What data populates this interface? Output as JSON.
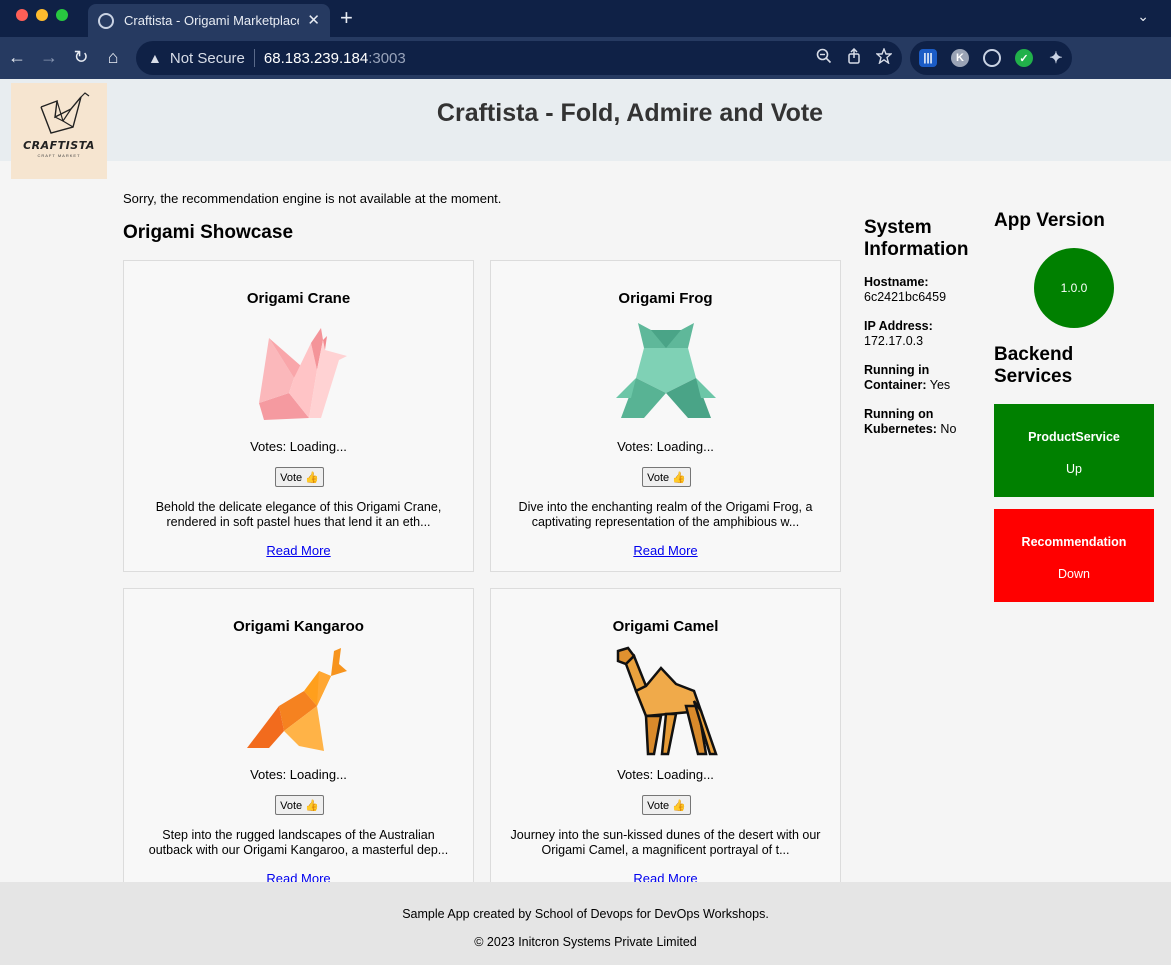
{
  "browser": {
    "tab_title": "Craftista - Origami Marketplace",
    "tab_close": "✕",
    "new_tab": "+",
    "security_label": "Not Secure",
    "url_host": "68.183.239.184",
    "url_port": ":3003",
    "ext_k": "K"
  },
  "header": {
    "logo_text": "CRAFTISTA",
    "logo_sub": "CRAFT MARKET",
    "title": "Craftista - Fold, Admire and Vote"
  },
  "main": {
    "recommendation_message": "Sorry, the recommendation engine is not available at the moment.",
    "showcase_title": "Origami Showcase",
    "products": [
      {
        "title": "Origami Crane",
        "votes": "Votes: Loading...",
        "vote_label": "Vote 👍",
        "description": "Behold the delicate elegance of this Origami Crane, rendered in soft pastel hues that lend it an eth...",
        "read_more": "Read More"
      },
      {
        "title": "Origami Frog",
        "votes": "Votes: Loading...",
        "vote_label": "Vote 👍",
        "description": "Dive into the enchanting realm of the Origami Frog, a captivating representation of the amphibious w...",
        "read_more": "Read More"
      },
      {
        "title": "Origami Kangaroo",
        "votes": "Votes: Loading...",
        "vote_label": "Vote 👍",
        "description": "Step into the rugged landscapes of the Australian outback with our Origami Kangaroo, a masterful dep...",
        "read_more": "Read More"
      },
      {
        "title": "Origami Camel",
        "votes": "Votes: Loading...",
        "vote_label": "Vote 👍",
        "description": "Journey into the sun-kissed dunes of the desert with our Origami Camel, a magnificent portrayal of t...",
        "read_more": "Read More"
      }
    ]
  },
  "system_info": {
    "title": "System Information",
    "hostname_label": "Hostname:",
    "hostname": "6c2421bc6459",
    "ip_label": "IP Address:",
    "ip": "172.17.0.3",
    "container_label": "Running in Container:",
    "container": "Yes",
    "kubernetes_label": "Running on Kubernetes:",
    "kubernetes": "No"
  },
  "app_version": {
    "title": "App Version",
    "version": "1.0.0"
  },
  "backend": {
    "title": "Backend Services",
    "services": [
      {
        "name": "ProductService",
        "status": "Up",
        "color": "#008000"
      },
      {
        "name": "Recommendation",
        "status": "Down",
        "color": "#ff0000"
      }
    ]
  },
  "footer": {
    "line1": "Sample App created by School of Devops for DevOps Workshops.",
    "line2": "© 2023 Initcron Systems Private Limited"
  }
}
